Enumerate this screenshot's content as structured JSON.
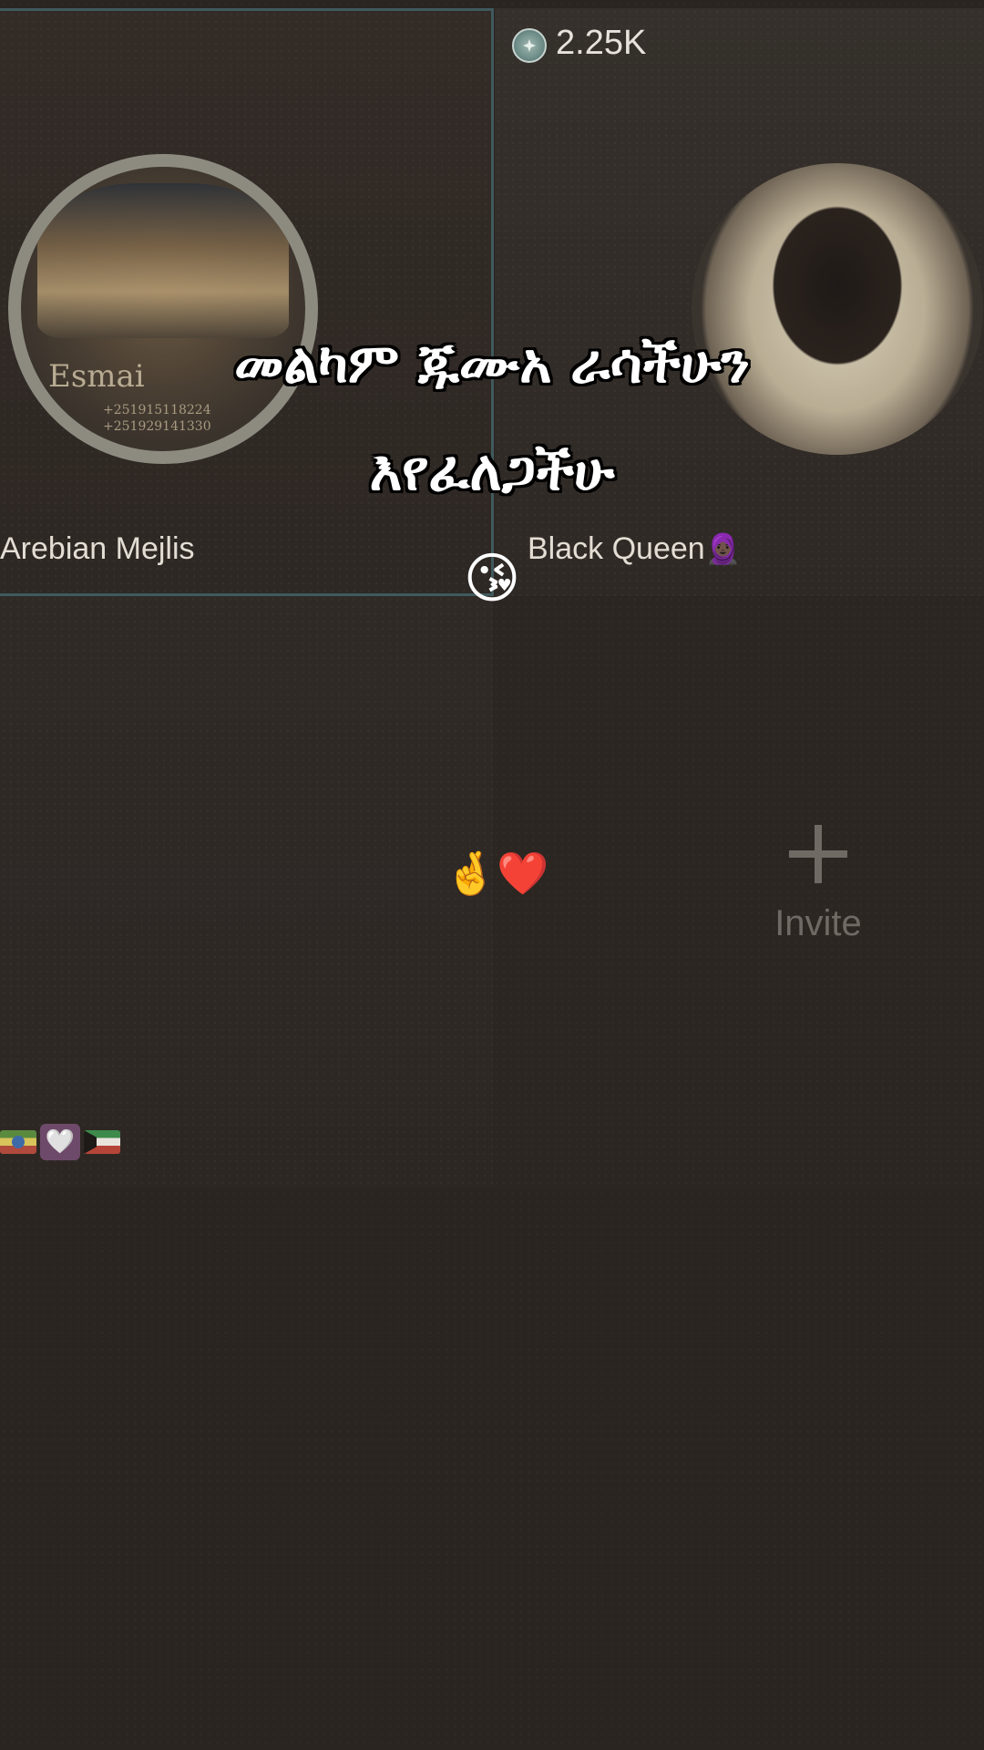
{
  "coins": {
    "count": "2.25K",
    "icon": "coin-icon"
  },
  "seats": [
    {
      "name": "Arebian Mejlis",
      "avatar": {
        "brand_text": "Esmai",
        "phone_lines": [
          "+251915118224",
          "+251929141330"
        ]
      }
    },
    {
      "name": "Black Queen",
      "name_emoji": "🧕🏿"
    },
    {
      "badge_icons": [
        "ethiopia-flag-icon",
        "heart-badge-icon",
        "kuwait-flag-icon"
      ],
      "badge_heart": "🤍"
    },
    {
      "invite_label": "Invite"
    }
  ],
  "center_reaction": "🤞❤️",
  "caption": {
    "line1": "መልካም ጁሙአ ራሳችሁን",
    "line2": "እየፈለጋችሁ",
    "emoji": "😘"
  }
}
